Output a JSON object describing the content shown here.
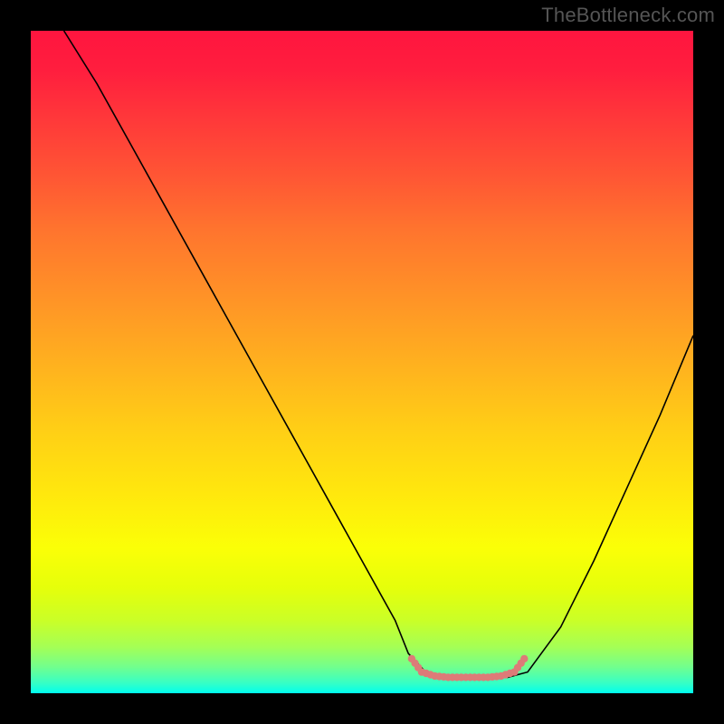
{
  "watermark": "TheBottleneck.com",
  "chart_data": {
    "type": "line",
    "title": "",
    "xlabel": "",
    "ylabel": "",
    "xlim": [
      0,
      100
    ],
    "ylim": [
      0,
      100
    ],
    "grid": false,
    "legend": false,
    "background_gradient": {
      "top": "#ff153f",
      "bottom": "#00ffef",
      "description": "vertical red-to-green heat gradient"
    },
    "series": [
      {
        "name": "curve",
        "color": "#000000",
        "x": [
          5,
          10,
          15,
          20,
          25,
          30,
          35,
          40,
          45,
          50,
          55,
          57,
          60,
          63,
          66,
          69,
          72,
          75,
          80,
          85,
          90,
          95,
          100
        ],
        "y": [
          100,
          92,
          83,
          74,
          65,
          56,
          47,
          38,
          29,
          20,
          11,
          6,
          2.8,
          2.4,
          2.4,
          2.4,
          2.4,
          3.2,
          10,
          20,
          31,
          42,
          54
        ]
      },
      {
        "name": "valley-marker",
        "color": "#dd7b78",
        "style": "thick-dotted",
        "x": [
          57.5,
          59,
          61,
          63,
          65,
          67,
          69,
          71,
          73,
          74.5
        ],
        "y": [
          5.2,
          3.2,
          2.6,
          2.4,
          2.4,
          2.4,
          2.4,
          2.6,
          3.2,
          5.2
        ]
      }
    ],
    "annotations": []
  }
}
